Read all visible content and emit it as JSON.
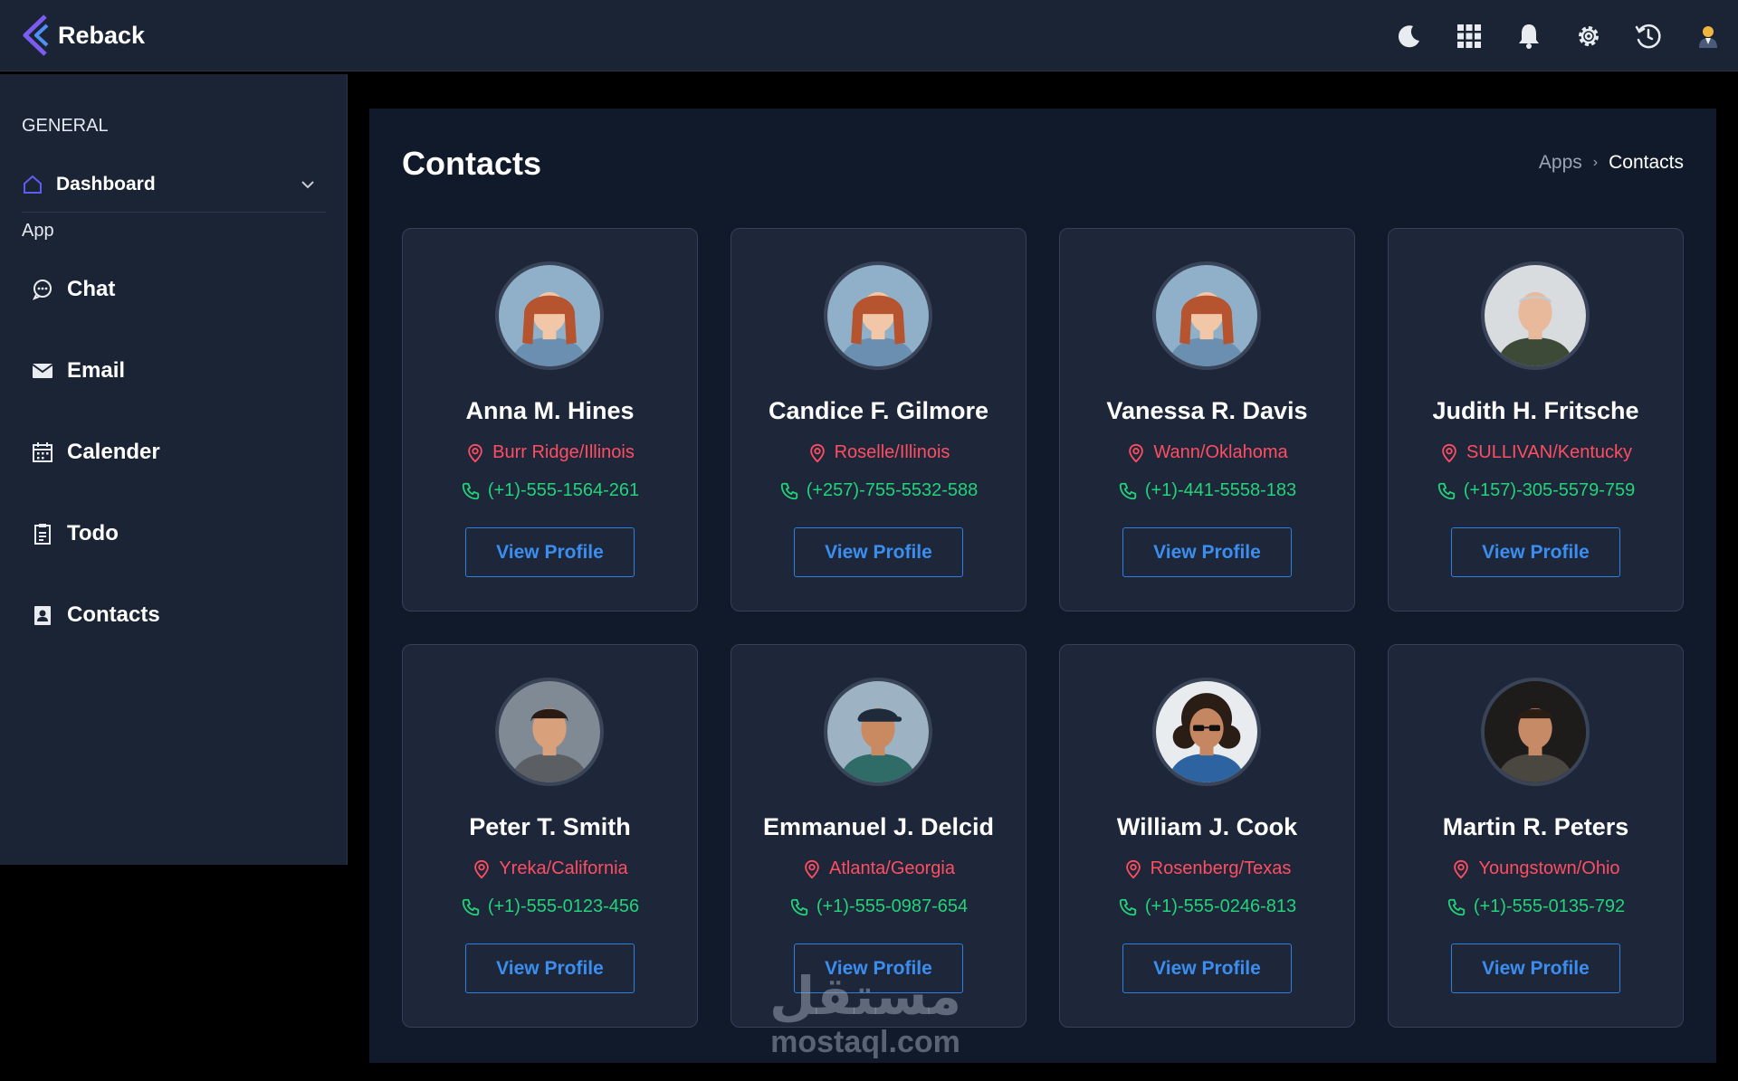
{
  "app": {
    "name": "Reback"
  },
  "topbar": {
    "icons": [
      "moon-icon",
      "apps-grid-icon",
      "bell-icon",
      "gear-icon",
      "history-icon",
      "user-avatar-icon"
    ]
  },
  "sidebar": {
    "section_general": "GENERAL",
    "dashboard_label": "Dashboard",
    "section_app": "App",
    "items": [
      {
        "label": "Chat",
        "icon": "chat-icon"
      },
      {
        "label": "Email",
        "icon": "mail-icon"
      },
      {
        "label": "Calender",
        "icon": "calendar-icon"
      },
      {
        "label": "Todo",
        "icon": "todo-icon"
      },
      {
        "label": "Contacts",
        "icon": "contacts-icon"
      }
    ]
  },
  "page": {
    "title": "Contacts",
    "breadcrumb": {
      "parent": "Apps",
      "separator": "›",
      "current": "Contacts"
    }
  },
  "contacts": [
    {
      "name": "Anna M. Hines",
      "location": "Burr Ridge/Illinois",
      "phone": "(+1)-555-1564-261",
      "button": "View Profile"
    },
    {
      "name": "Candice F. Gilmore",
      "location": "Roselle/Illinois",
      "phone": "(+257)-755-5532-588",
      "button": "View Profile"
    },
    {
      "name": "Vanessa R. Davis",
      "location": "Wann/Oklahoma",
      "phone": "(+1)-441-5558-183",
      "button": "View Profile"
    },
    {
      "name": "Judith H. Fritsche",
      "location": "SULLIVAN/Kentucky",
      "phone": "(+157)-305-5579-759",
      "button": "View Profile"
    },
    {
      "name": "Peter T. Smith",
      "location": "Yreka/California",
      "phone": "(+1)-555-0123-456",
      "button": "View Profile"
    },
    {
      "name": "Emmanuel J. Delcid",
      "location": "Atlanta/Georgia",
      "phone": "(+1)-555-0987-654",
      "button": "View Profile"
    },
    {
      "name": "William J. Cook",
      "location": "Rosenberg/Texas",
      "phone": "(+1)-555-0246-813",
      "button": "View Profile"
    },
    {
      "name": "Martin R. Peters",
      "location": "Youngstown/Ohio",
      "phone": "(+1)-555-0135-792",
      "button": "View Profile"
    }
  ],
  "watermark": {
    "arabic": "مستقل",
    "latin": "mostaql.com"
  },
  "colors": {
    "background": "#111a2b",
    "panel": "#1b2435",
    "card": "#1d2739",
    "location": "#ff4d62",
    "phone": "#22d37a",
    "button": "#3b8ef0",
    "brand_accent": "#6c4ce6"
  }
}
